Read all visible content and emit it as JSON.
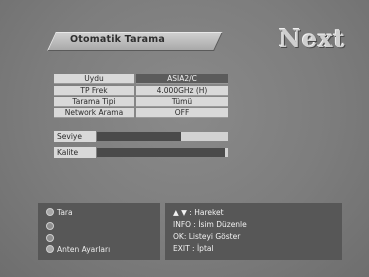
{
  "header": {
    "title": "Otomatik Tarama",
    "brand": "Next"
  },
  "settings": [
    {
      "label": "Uydu",
      "value": "ASIA2/C",
      "selected": true
    },
    {
      "label": "TP Frek",
      "value": "4.000GHz (H)",
      "selected": false
    },
    {
      "label": "Tarama Tipi",
      "value": "Tümü",
      "selected": false
    },
    {
      "label": "Network Arama",
      "value": "OFF",
      "selected": false
    }
  ],
  "signal": {
    "level_label": "Seviye",
    "level_fraction": 0.64,
    "quality_label": "Kalite",
    "quality_fraction": 0.98
  },
  "options": {
    "scan": "Tara",
    "antenna": "Anten Ayarları"
  },
  "help": {
    "move": "▲ ▼ : Hareket",
    "info": "INFO : İsim Düzenle",
    "ok": "OK: Listeyi Göster",
    "exit": "EXIT : İptal"
  }
}
